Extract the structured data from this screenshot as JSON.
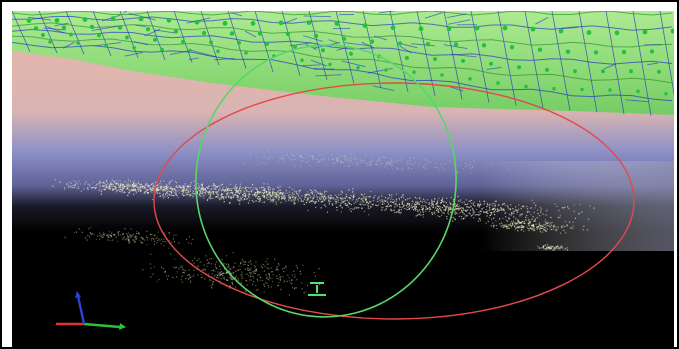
{
  "viewer": {
    "view": "3d-viewport",
    "content": "point-cloud",
    "background_top_color": "#e9b6a9",
    "background_mid_color": "#8c90c6",
    "background_bottom_color": "#000000",
    "grid_color": "#7fe16a",
    "grid_line_color": "#1f2fc4",
    "node_color": "#22c33a",
    "point_color": "#f0eec0"
  },
  "rotation_gizmo": {
    "horizontal_ring_color": "#e24a4a",
    "vertical_ring_color": "#59d66a",
    "center_marker_color": "#4ee36c"
  },
  "axis_triad": {
    "x_color": "#e23232",
    "y_color": "#27c43b",
    "z_color": "#2a43e0"
  }
}
